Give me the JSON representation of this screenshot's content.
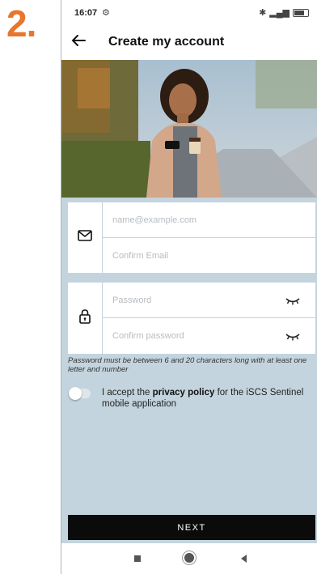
{
  "step": {
    "number": "2."
  },
  "status_bar": {
    "time": "16:07"
  },
  "header": {
    "title": "Create my account"
  },
  "email_group": {
    "email_placeholder": "name@example.com",
    "confirm_placeholder": "Confirm Email"
  },
  "password_group": {
    "password_placeholder": "Password",
    "confirm_placeholder": "Confirm password"
  },
  "password_hint": "Password must be between 6 and 20 characters long with at least one letter and number",
  "consent": {
    "prefix": "I accept the ",
    "link": "privacy policy",
    "suffix": " for the iSCS Sentinel mobile application",
    "checked": false
  },
  "next_button": {
    "label": "NEXT"
  },
  "colors": {
    "accent_orange": "#e8762c",
    "form_background": "#c3d4de",
    "button": "#0b0b0b"
  },
  "icons": {
    "back": "back-arrow-icon",
    "email": "envelope-icon",
    "password": "lock-icon",
    "reveal": "eye-closed-icon"
  }
}
